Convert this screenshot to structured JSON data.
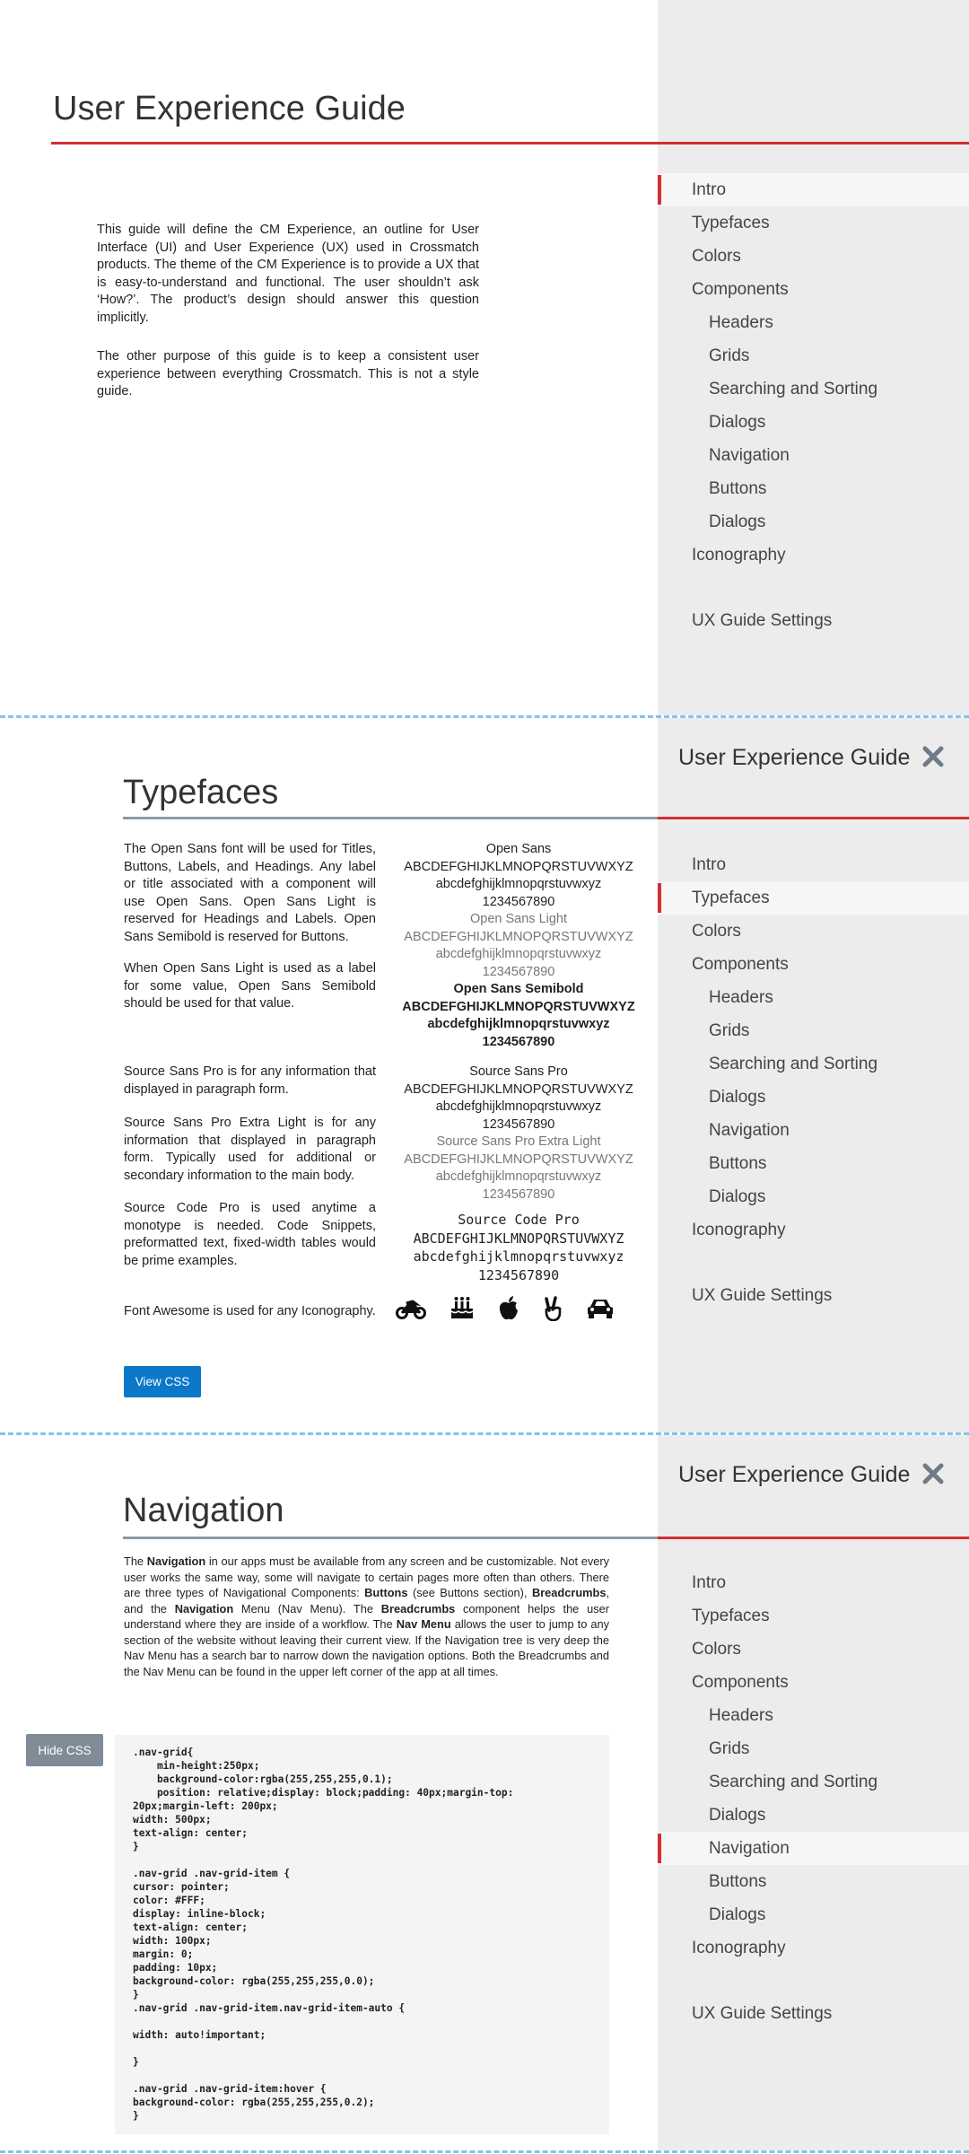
{
  "app_title": "User Experience Guide",
  "sidebar": {
    "items": [
      {
        "label": "Intro"
      },
      {
        "label": "Typefaces"
      },
      {
        "label": "Colors"
      },
      {
        "label": "Components"
      },
      {
        "label": "Headers"
      },
      {
        "label": "Grids"
      },
      {
        "label": "Searching and Sorting"
      },
      {
        "label": "Dialogs"
      },
      {
        "label": "Navigation"
      },
      {
        "label": "Buttons"
      },
      {
        "label": "Dialogs"
      },
      {
        "label": "Iconography"
      }
    ],
    "settings_label": "UX Guide Settings"
  },
  "intro": {
    "paragraph1": "This guide will define the CM Experience, an outline for User Interface (UI) and User Experience (UX) used in Crossmatch products. The theme of the CM Experience is to provide a UX that is easy-to-understand and functional. The user shouldn’t ask ‘How?’. The product’s design should answer this question implicitly.",
    "paragraph2": "The other purpose of this guide is to keep a consistent user experience between everything Crossmatch. This is not a style guide."
  },
  "typefaces": {
    "heading": "Typefaces",
    "open_sans_p1": "The Open Sans font will be used for Titles, Buttons, Labels, and Headings. Any label or title associated with a component will use Open Sans. Open Sans Light is reserved for Headings and Labels. Open Sans Semibold is reserved for Buttons.",
    "open_sans_p2": "When Open Sans Light is used as a label for some value, Open Sans Semibold should be used for that value.",
    "source_sans_p1": "Source Sans Pro is for any information that displayed in paragraph form.",
    "source_sans_p2": "Source Sans Pro Extra Light is for any information that displayed in paragraph form. Typically used for additional or secondary information to the main body.",
    "source_code_p": "Source Code Pro is used anytime a monotype is needed. Code Snippets, preformatted text, fixed-width tables would be prime examples.",
    "font_awesome_p": "Font Awesome is used for any Iconography.",
    "uppercase": "ABCDEFGHIJKLMNOPQRSTUVWXYZ",
    "lowercase": "abcdefghijklmnopqrstuvwxyz",
    "digits": "1234567890",
    "samples": {
      "open_sans": "Open Sans",
      "open_sans_light": "Open Sans Light",
      "open_sans_semibold": "Open Sans Semibold",
      "source_sans_pro": "Source Sans Pro",
      "source_sans_extra_light": "Source Sans Pro Extra Light",
      "source_code_pro": "Source Code Pro"
    },
    "icons": [
      "motorcycle-icon",
      "birthday-cake-icon",
      "apple-icon",
      "hand-peace-icon",
      "car-icon"
    ],
    "view_css_label": "View CSS"
  },
  "navigation": {
    "heading": "Navigation",
    "hide_css_label": "Hide CSS",
    "paragraph": {
      "t1": "The ",
      "b1": "Navigation",
      "t2": " in our apps must be available from any screen and be customizable. Not every user works the same way, some will navigate to certain pages more often than others. There are three types of Navigational Components: ",
      "b2": "Buttons",
      "t3": " (see Buttons section), ",
      "b3": "Breadcrumbs",
      "t4": ", and the ",
      "b4": "Navigation",
      "t5": " Menu (Nav Menu). The ",
      "b5": "Breadcrumbs",
      "t6": " component helps the user understand where they are inside of a workflow.  The ",
      "b6": "Nav Menu",
      "t7": " allows the user to jump to any section of the website without leaving their current view. If the Navigation tree is very deep the Nav Menu has a search bar to narrow down the navigation options.  Both the Breadcrumbs and the Nav Menu can be found in the upper left corner of the app at all times."
    },
    "css_code": ".nav-grid{\n    min-height:250px;\n    background-color:rgba(255,255,255,0.1);\n    position: relative;display: block;padding: 40px;margin-top:\n20px;margin-left: 200px;\nwidth: 500px;\ntext-align: center;\n}\n\n.nav-grid .nav-grid-item {\ncursor: pointer;\ncolor: #FFF;\ndisplay: inline-block;\ntext-align: center;\nwidth: 100px;\nmargin: 0;\npadding: 10px;\nbackground-color: rgba(255,255,255,0.0);\n}\n.nav-grid .nav-grid-item.nav-grid-item-auto {\n\nwidth: auto!important;\n\n}\n\n.nav-grid .nav-grid-item:hover {\nbackground-color: rgba(255,255,255,0.2);\n}"
  },
  "colors": {
    "accent_red": "#d32f2f",
    "sidebar_bg": "#ececec",
    "button_blue": "#0b78c9",
    "button_gray": "#7f8c97",
    "divider_gray": "#8f9aa3",
    "panel_separator": "#7cc7ec"
  }
}
